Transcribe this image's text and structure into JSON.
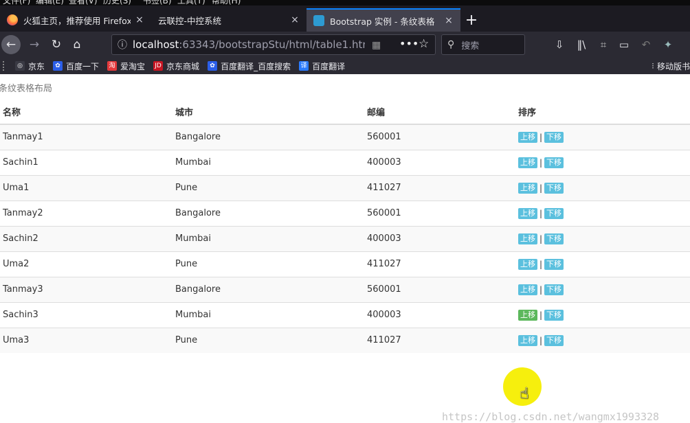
{
  "browser": {
    "menu": [
      "文件(F)",
      "编辑(E)",
      "查看(V)",
      "历史(S)",
      "书签(B)",
      "工具(T)",
      "帮助(H)"
    ],
    "tabs": [
      {
        "title": "火狐主页，推荐使用 Firefox 火狐",
        "close": "×"
      },
      {
        "title": "云联控-中控系统",
        "close": "×"
      },
      {
        "title": "Bootstrap 实例 - 条纹表格",
        "close": "×"
      }
    ],
    "new_tab": "+",
    "url_host": "localhost",
    "url_path": ":63343/bootstrapStu/html/table1.htm",
    "search_placeholder": "搜索",
    "bookmarks": [
      {
        "label": "京东",
        "icon": "globe-icon",
        "color": "#3a3a44"
      },
      {
        "label": "百度一下",
        "icon": "baidu-icon",
        "color": "#2b5ee8"
      },
      {
        "label": "爱淘宝",
        "icon": "taobao-icon",
        "color": "#e4393c"
      },
      {
        "label": "京东商城",
        "icon": "jd-icon",
        "color": "#c81623"
      },
      {
        "label": "百度翻译_百度搜索",
        "icon": "baidu-icon",
        "color": "#2b5ee8"
      },
      {
        "label": "百度翻译",
        "icon": "translate-icon",
        "color": "#2b7bff"
      }
    ],
    "bookmarks_right": "移动版书"
  },
  "page": {
    "caption": "条纹表格布局",
    "headers": [
      "名称",
      "城市",
      "邮编",
      "排序"
    ],
    "up_label": "上移",
    "down_label": "下移",
    "separator": "|",
    "rows": [
      [
        "Tanmay1",
        "Bangalore",
        "560001"
      ],
      [
        "Sachin1",
        "Mumbai",
        "400003"
      ],
      [
        "Uma1",
        "Pune",
        "411027"
      ],
      [
        "Tanmay2",
        "Bangalore",
        "560001"
      ],
      [
        "Sachin2",
        "Mumbai",
        "400003"
      ],
      [
        "Uma2",
        "Pune",
        "411027"
      ],
      [
        "Tanmay3",
        "Bangalore",
        "560001"
      ],
      [
        "Sachin3",
        "Mumbai",
        "400003"
      ],
      [
        "Uma3",
        "Pune",
        "411027"
      ]
    ],
    "highlight_row": 7,
    "watermark": "https://blog.csdn.net/wangmx1993328"
  },
  "colors": {
    "info_button": "#5bc0de",
    "active_button": "#5cb85c",
    "cursor_highlight": "#f6ee00",
    "tab_accent": "#0a84ff"
  }
}
